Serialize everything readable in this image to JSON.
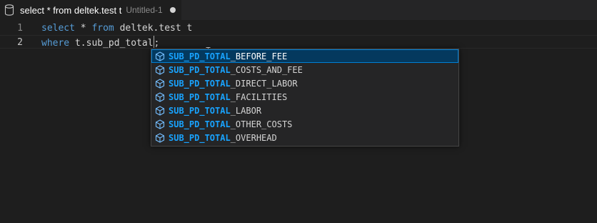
{
  "tab": {
    "title": "select * from deltek.test t",
    "subtitle": "Untitled-1",
    "icon": "database-icon",
    "dirty_indicator": "unsaved-dot-icon"
  },
  "editor": {
    "lines": [
      {
        "number": "1",
        "tokens": [
          {
            "text": "select",
            "type": "keyword"
          },
          {
            "text": " * ",
            "type": "plain"
          },
          {
            "text": "from",
            "type": "keyword"
          },
          {
            "text": " deltek.test t",
            "type": "plain"
          }
        ]
      },
      {
        "number": "2",
        "tokens": [
          {
            "text": "where",
            "type": "keyword"
          },
          {
            "text": " t.sub_pd_total",
            "type": "plain"
          },
          {
            "text": ";",
            "type": "plain"
          }
        ]
      }
    ]
  },
  "suggestions": {
    "match_prefix": "SUB_PD_TOTAL",
    "items": [
      {
        "label": "SUB_PD_TOTAL_BEFORE_FEE",
        "icon": "field-icon",
        "selected": true
      },
      {
        "label": "SUB_PD_TOTAL_COSTS_AND_FEE",
        "icon": "field-icon",
        "selected": false
      },
      {
        "label": "SUB_PD_TOTAL_DIRECT_LABOR",
        "icon": "field-icon",
        "selected": false
      },
      {
        "label": "SUB_PD_TOTAL_FACILITIES",
        "icon": "field-icon",
        "selected": false
      },
      {
        "label": "SUB_PD_TOTAL_LABOR",
        "icon": "field-icon",
        "selected": false
      },
      {
        "label": "SUB_PD_TOTAL_OTHER_COSTS",
        "icon": "field-icon",
        "selected": false
      },
      {
        "label": "SUB_PD_TOTAL_OVERHEAD",
        "icon": "field-icon",
        "selected": false
      }
    ]
  },
  "colors": {
    "editor_bg": "#1e1e1e",
    "keyword": "#569cd6",
    "match_highlight": "#18a3ff",
    "selection_bg": "#04395e",
    "icon_blue": "#75beff"
  }
}
